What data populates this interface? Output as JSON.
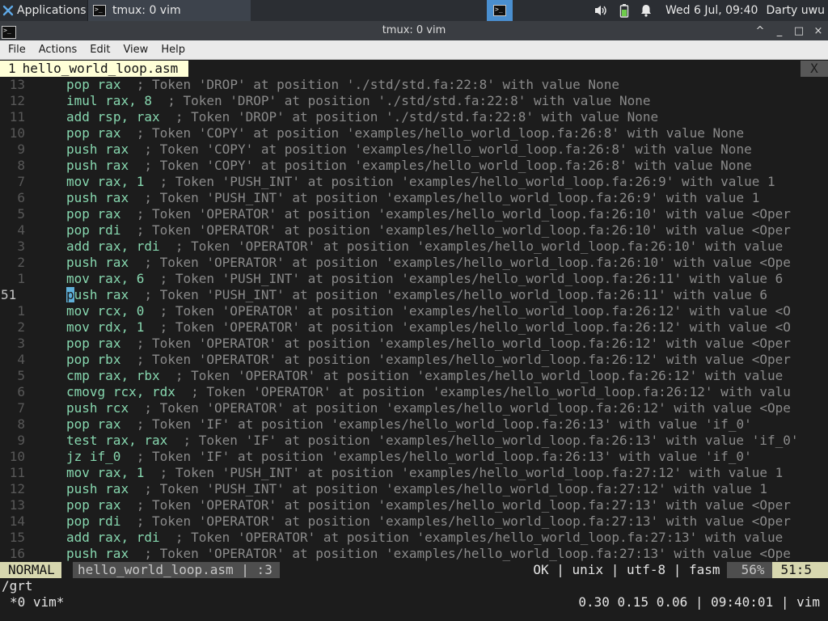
{
  "panel": {
    "applications_label": "Applications",
    "task_title": "tmux: 0 vim",
    "clock": "Wed  6 Jul, 09:40",
    "user": "Darty uwu",
    "icons": {
      "menu": "xfce-mouse-icon",
      "volume": "volume-icon",
      "battery": "battery-icon",
      "notifications": "bell-icon"
    },
    "colors": {
      "bg": "#2b2e33",
      "active_task": "#4a8fd0"
    }
  },
  "window": {
    "title": "tmux: 0 vim",
    "controls": [
      "^",
      "_",
      "□",
      "×"
    ]
  },
  "menubar": {
    "items": [
      "File",
      "Actions",
      "Edit",
      "View",
      "Help"
    ]
  },
  "vim": {
    "tab": {
      "number": "1",
      "name": "hello_world_loop.asm",
      "close": "X"
    },
    "lines": [
      {
        "ln": "13",
        "op": "pop",
        "args": "rax",
        "comment": "; Token 'DROP' at position './std/std.fa:22:8' with value None"
      },
      {
        "ln": "12",
        "op": "imul",
        "args": "rax, 8",
        "comment": "; Token 'DROP' at position './std/std.fa:22:8' with value None"
      },
      {
        "ln": "11",
        "op": "add",
        "args": "rsp, rax",
        "comment": "; Token 'DROP' at position './std/std.fa:22:8' with value None"
      },
      {
        "ln": "10",
        "op": "pop",
        "args": "rax",
        "comment": "; Token 'COPY' at position 'examples/hello_world_loop.fa:26:8' with value None"
      },
      {
        "ln": "9",
        "op": "push",
        "args": "rax",
        "comment": "; Token 'COPY' at position 'examples/hello_world_loop.fa:26:8' with value None"
      },
      {
        "ln": "8",
        "op": "push",
        "args": "rax",
        "comment": "; Token 'COPY' at position 'examples/hello_world_loop.fa:26:8' with value None"
      },
      {
        "ln": "7",
        "op": "mov",
        "args": "rax, 1",
        "comment": "; Token 'PUSH_INT' at position 'examples/hello_world_loop.fa:26:9' with value 1"
      },
      {
        "ln": "6",
        "op": "push",
        "args": "rax",
        "comment": "; Token 'PUSH_INT' at position 'examples/hello_world_loop.fa:26:9' with value 1"
      },
      {
        "ln": "5",
        "op": "pop",
        "args": "rax",
        "comment": "; Token 'OPERATOR' at position 'examples/hello_world_loop.fa:26:10' with value <Oper"
      },
      {
        "ln": "4",
        "op": "pop",
        "args": "rdi",
        "comment": "; Token 'OPERATOR' at position 'examples/hello_world_loop.fa:26:10' with value <Oper"
      },
      {
        "ln": "3",
        "op": "add",
        "args": "rax, rdi",
        "comment": "; Token 'OPERATOR' at position 'examples/hello_world_loop.fa:26:10' with value"
      },
      {
        "ln": "2",
        "op": "push",
        "args": "rax",
        "comment": "; Token 'OPERATOR' at position 'examples/hello_world_loop.fa:26:10' with value <Ope"
      },
      {
        "ln": "1",
        "op": "mov",
        "args": "rax, 6",
        "comment": "; Token 'PUSH_INT' at position 'examples/hello_world_loop.fa:26:11' with value 6"
      },
      {
        "ln": "51",
        "op": "push",
        "args": "rax",
        "comment": "; Token 'PUSH_INT' at position 'examples/hello_world_loop.fa:26:11' with value 6",
        "current": true
      },
      {
        "ln": "1",
        "op": "mov",
        "args": "rcx, 0",
        "comment": "; Token 'OPERATOR' at position 'examples/hello_world_loop.fa:26:12' with value <O"
      },
      {
        "ln": "2",
        "op": "mov",
        "args": "rdx, 1",
        "comment": "; Token 'OPERATOR' at position 'examples/hello_world_loop.fa:26:12' with value <O"
      },
      {
        "ln": "3",
        "op": "pop",
        "args": "rax",
        "comment": "; Token 'OPERATOR' at position 'examples/hello_world_loop.fa:26:12' with value <Oper"
      },
      {
        "ln": "4",
        "op": "pop",
        "args": "rbx",
        "comment": "; Token 'OPERATOR' at position 'examples/hello_world_loop.fa:26:12' with value <Oper"
      },
      {
        "ln": "5",
        "op": "cmp",
        "args": "rax, rbx",
        "comment": "; Token 'OPERATOR' at position 'examples/hello_world_loop.fa:26:12' with value"
      },
      {
        "ln": "6",
        "op": "cmovg",
        "args": "rcx, rdx",
        "comment": "; Token 'OPERATOR' at position 'examples/hello_world_loop.fa:26:12' with valu"
      },
      {
        "ln": "7",
        "op": "push",
        "args": "rcx",
        "comment": "; Token 'OPERATOR' at position 'examples/hello_world_loop.fa:26:12' with value <Ope"
      },
      {
        "ln": "8",
        "op": "pop",
        "args": "rax",
        "comment": "; Token 'IF' at position 'examples/hello_world_loop.fa:26:13' with value 'if_0'"
      },
      {
        "ln": "9",
        "op": "test",
        "args": "rax, rax",
        "comment": "; Token 'IF' at position 'examples/hello_world_loop.fa:26:13' with value 'if_0'"
      },
      {
        "ln": "10",
        "op": "jz",
        "args": "if_0",
        "comment": "; Token 'IF' at position 'examples/hello_world_loop.fa:26:13' with value 'if_0'"
      },
      {
        "ln": "11",
        "op": "mov",
        "args": "rax, 1",
        "comment": "; Token 'PUSH_INT' at position 'examples/hello_world_loop.fa:27:12' with value 1"
      },
      {
        "ln": "12",
        "op": "push",
        "args": "rax",
        "comment": "; Token 'PUSH_INT' at position 'examples/hello_world_loop.fa:27:12' with value 1"
      },
      {
        "ln": "13",
        "op": "pop",
        "args": "rax",
        "comment": "; Token 'OPERATOR' at position 'examples/hello_world_loop.fa:27:13' with value <Oper"
      },
      {
        "ln": "14",
        "op": "pop",
        "args": "rdi",
        "comment": "; Token 'OPERATOR' at position 'examples/hello_world_loop.fa:27:13' with value <Oper"
      },
      {
        "ln": "15",
        "op": "add",
        "args": "rax, rdi",
        "comment": "; Token 'OPERATOR' at position 'examples/hello_world_loop.fa:27:13' with value"
      },
      {
        "ln": "16",
        "op": "push",
        "args": "rax",
        "comment": "; Token 'OPERATOR' at position 'examples/hello_world_loop.fa:27:13' with value <Ope"
      }
    ],
    "status": {
      "mode": "NORMAL",
      "file": "hello_world_loop.asm | :3",
      "info": "OK | unix | utf-8 | fasm",
      "percent": "56%",
      "position": "51:5"
    },
    "cmdline": "/grt"
  },
  "tmux": {
    "window": "*0 vim*",
    "right": "0.30 0.15 0.06 | 09:40:01 | vim"
  }
}
